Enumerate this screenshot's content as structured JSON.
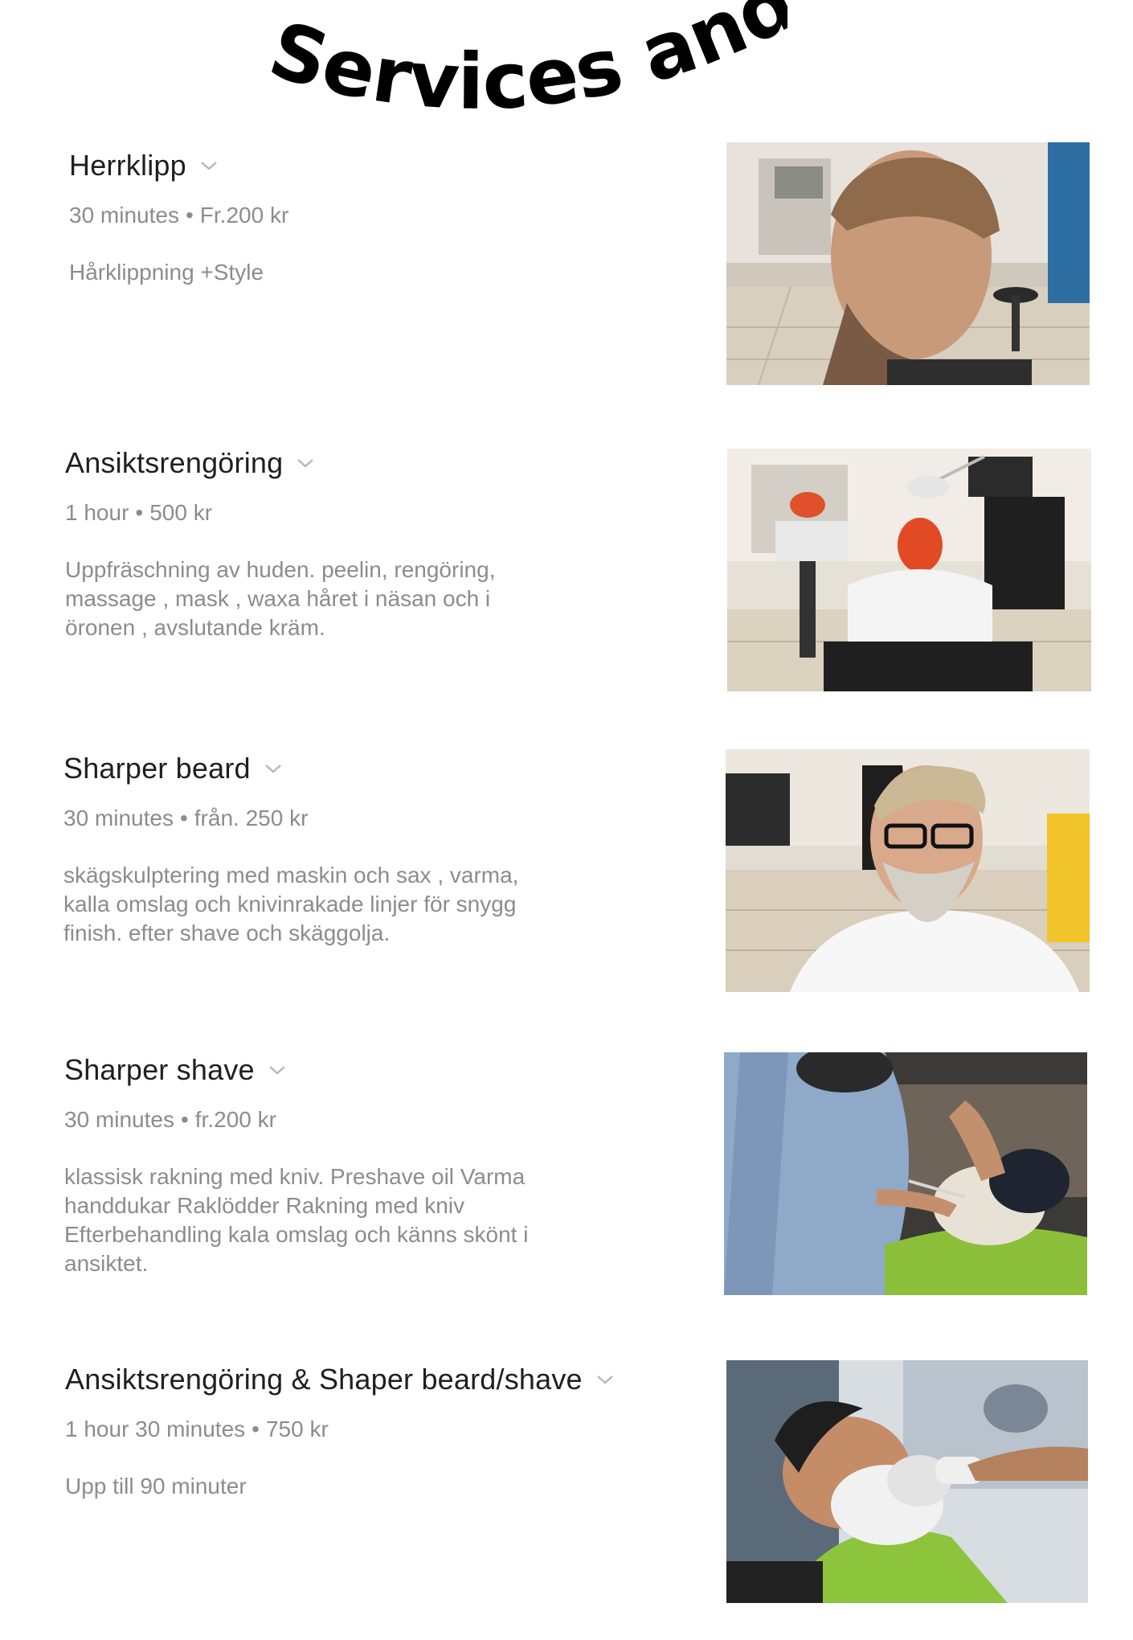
{
  "page": {
    "title": "Services and Prices"
  },
  "services": [
    {
      "name": "Herrklipp",
      "duration": "30 minutes",
      "price": "Fr.200 kr",
      "description": "Hårklippning +Style",
      "photo_icon": "haircut-photo"
    },
    {
      "name": "Ansiktsrengöring",
      "duration": "1 hour",
      "price": "500 kr",
      "description": "Uppfräschning av huden. peelin, rengöring, massage , mask , waxa håret i näsan och i öronen , avslutande kräm.",
      "photo_icon": "facial-treatment-photo"
    },
    {
      "name": "Sharper beard",
      "duration": "30 minutes",
      "price": "från. 250 kr",
      "description": "skägskulptering med maskin och sax , varma, kalla omslag och knivinrakade linjer för snygg finish. efter shave och skäggolja.",
      "photo_icon": "beard-photo"
    },
    {
      "name": "Sharper shave",
      "duration": "30 minutes",
      "price": "fr.200 kr",
      "description": "klassisk rakning med kniv. Preshave oil Varma handdukar Raklödder Rakning med kniv Efterbehandling kala omslag och känns skönt i ansiktet.",
      "photo_icon": "razor-shave-photo"
    },
    {
      "name": "Ansiktsrengöring & Shaper beard/shave",
      "duration": "1 hour 30 minutes",
      "price": "750 kr",
      "description": "Upp till 90 minuter",
      "photo_icon": "shaving-brush-photo"
    }
  ],
  "colors": {
    "title": "#000000",
    "name": "#1f1f1f",
    "meta": "#8c8c8c",
    "chevron": "#b8b8b8"
  }
}
